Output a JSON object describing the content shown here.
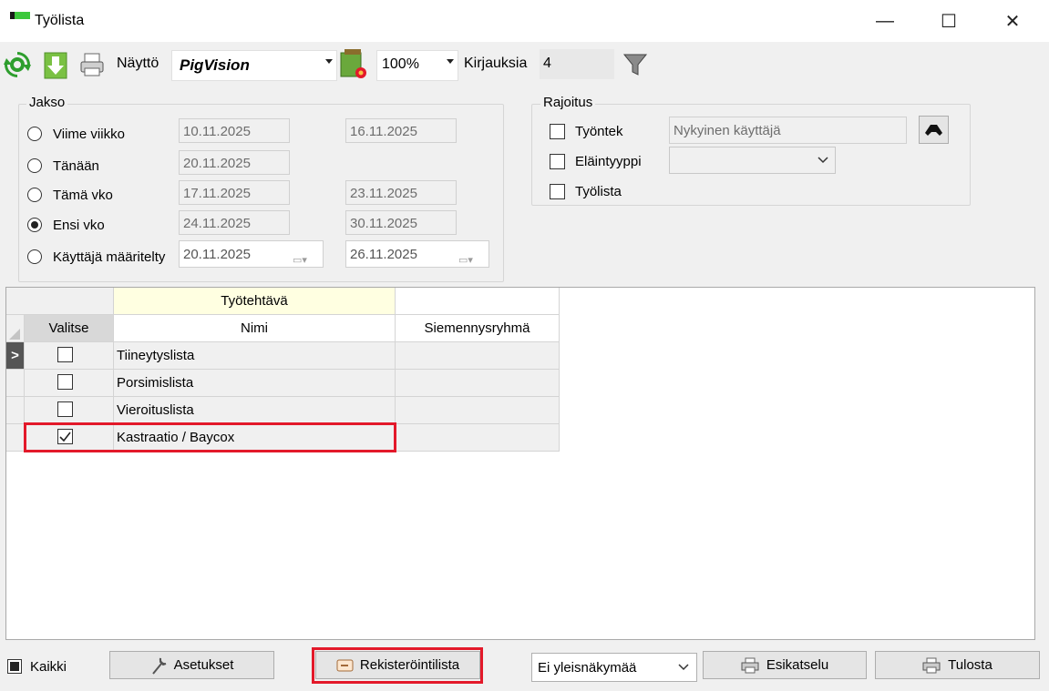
{
  "window": {
    "title": "Työlista",
    "minimize_icon": "—",
    "maximize_icon": "☐",
    "close_icon": "✕"
  },
  "toolbar": {
    "display_label": "Näyttö",
    "display_value": "PigVision",
    "zoom_value": "100%",
    "records_label": "Kirjauksia",
    "records_value": "4",
    "icons": [
      "refresh-icon",
      "download-icon",
      "print-icon",
      "settings-gear-icon",
      "filter-icon"
    ]
  },
  "period": {
    "title": "Jakso",
    "options": [
      {
        "label": "Viime viikko",
        "from": "10.11.2025",
        "to": "16.11.2025",
        "selected": false
      },
      {
        "label": "Tänään",
        "from": "20.11.2025",
        "to": "",
        "selected": false
      },
      {
        "label": "Tämä vko",
        "from": "17.11.2025",
        "to": "23.11.2025",
        "selected": false
      },
      {
        "label": "Ensi vko",
        "from": "24.11.2025",
        "to": "30.11.2025",
        "selected": true
      },
      {
        "label": "Käyttäjä määritelty",
        "from": "20.11.2025",
        "to": "26.11.2025",
        "selected": false
      }
    ]
  },
  "restriction": {
    "title": "Rajoitus",
    "employee_label": "Työntek",
    "employee_value": "Nykyinen käyttäjä",
    "animal_type_label": "Eläintyyppi",
    "animal_type_value": "",
    "worklist_label": "Työlista"
  },
  "grid": {
    "group_header": "Työtehtävä",
    "columns": [
      "Valitse",
      "Nimi",
      "Siemennysryhmä"
    ],
    "row_pointer": ">",
    "rows": [
      {
        "name": "Tiineytyslista",
        "group": "",
        "checked": false
      },
      {
        "name": "Porsimislista",
        "group": "",
        "checked": false
      },
      {
        "name": "Vieroituslista",
        "group": "",
        "checked": false
      },
      {
        "name": "Kastraatio / Baycox",
        "group": "",
        "checked": true
      }
    ]
  },
  "bottom": {
    "all_label": "Kaikki",
    "settings_label": "Asetukset",
    "registration_label": "Rekisteröintilista",
    "view_value": "Ei yleisnäkymää",
    "preview_label": "Esikatselu",
    "print_label": "Tulosta"
  },
  "colors": {
    "highlight": "#e3192a",
    "group_header_bg": "#ffffe1"
  }
}
